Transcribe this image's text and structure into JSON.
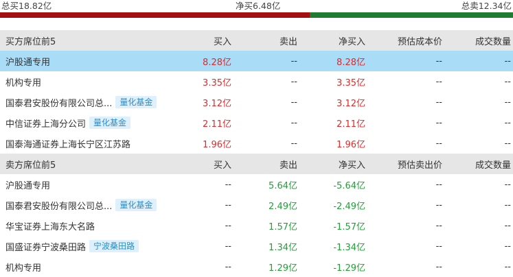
{
  "summary": {
    "total_buy": "总买18.82亿",
    "net_buy": "净买6.48亿",
    "total_sell": "总卖12.34亿"
  },
  "colors": {
    "buy_bar": "#a50f12",
    "sell_bar": "#1e7b32",
    "up": "#e02a2a",
    "down": "#21a038",
    "highlight": "#a9dcf7",
    "tag_bg": "#ddf0fb",
    "tag_text": "#2a8ec9"
  },
  "bar_ratio": {
    "buy_share": 0.604
  },
  "buy_table": {
    "headers": {
      "name": "买方席位前5",
      "buy": "买入",
      "sell": "卖出",
      "net": "净买入",
      "cost": "预估成本价",
      "qty": "成交数量"
    },
    "rows": [
      {
        "name": "沪股通专用",
        "tag": "",
        "buy": "8.28亿",
        "sell": "--",
        "net": "8.28亿",
        "cost": "--",
        "qty": "--"
      },
      {
        "name": "机构专用",
        "tag": "",
        "buy": "3.35亿",
        "sell": "--",
        "net": "3.35亿",
        "cost": "--",
        "qty": "--"
      },
      {
        "name": "国泰君安股份有限公司总...",
        "tag": "量化基金",
        "buy": "3.12亿",
        "sell": "--",
        "net": "3.12亿",
        "cost": "--",
        "qty": "--"
      },
      {
        "name": "中信证券上海分公司",
        "tag": "量化基金",
        "buy": "2.11亿",
        "sell": "--",
        "net": "2.11亿",
        "cost": "--",
        "qty": "--"
      },
      {
        "name": "国泰海通证券上海长宁区江苏路",
        "tag": "",
        "buy": "1.96亿",
        "sell": "--",
        "net": "1.96亿",
        "cost": "--",
        "qty": "--"
      }
    ]
  },
  "sell_table": {
    "headers": {
      "name": "卖方席位前5",
      "buy": "买入",
      "sell": "卖出",
      "net": "净买入",
      "cost": "预估卖出价",
      "qty": "成交数量"
    },
    "rows": [
      {
        "name": "沪股通专用",
        "tag": "",
        "buy": "--",
        "sell": "5.64亿",
        "net": "-5.64亿",
        "cost": "--",
        "qty": "--"
      },
      {
        "name": "国泰君安股份有限公司总...",
        "tag": "量化基金",
        "buy": "--",
        "sell": "2.49亿",
        "net": "-2.49亿",
        "cost": "--",
        "qty": "--"
      },
      {
        "name": "华宝证券上海东大名路",
        "tag": "",
        "buy": "--",
        "sell": "1.57亿",
        "net": "-1.57亿",
        "cost": "--",
        "qty": "--"
      },
      {
        "name": "国盛证券宁波桑田路",
        "tag": "宁波桑田路",
        "buy": "--",
        "sell": "1.34亿",
        "net": "-1.34亿",
        "cost": "--",
        "qty": "--"
      },
      {
        "name": "机构专用",
        "tag": "",
        "buy": "--",
        "sell": "1.29亿",
        "net": "-1.29亿",
        "cost": "--",
        "qty": "--"
      }
    ]
  }
}
